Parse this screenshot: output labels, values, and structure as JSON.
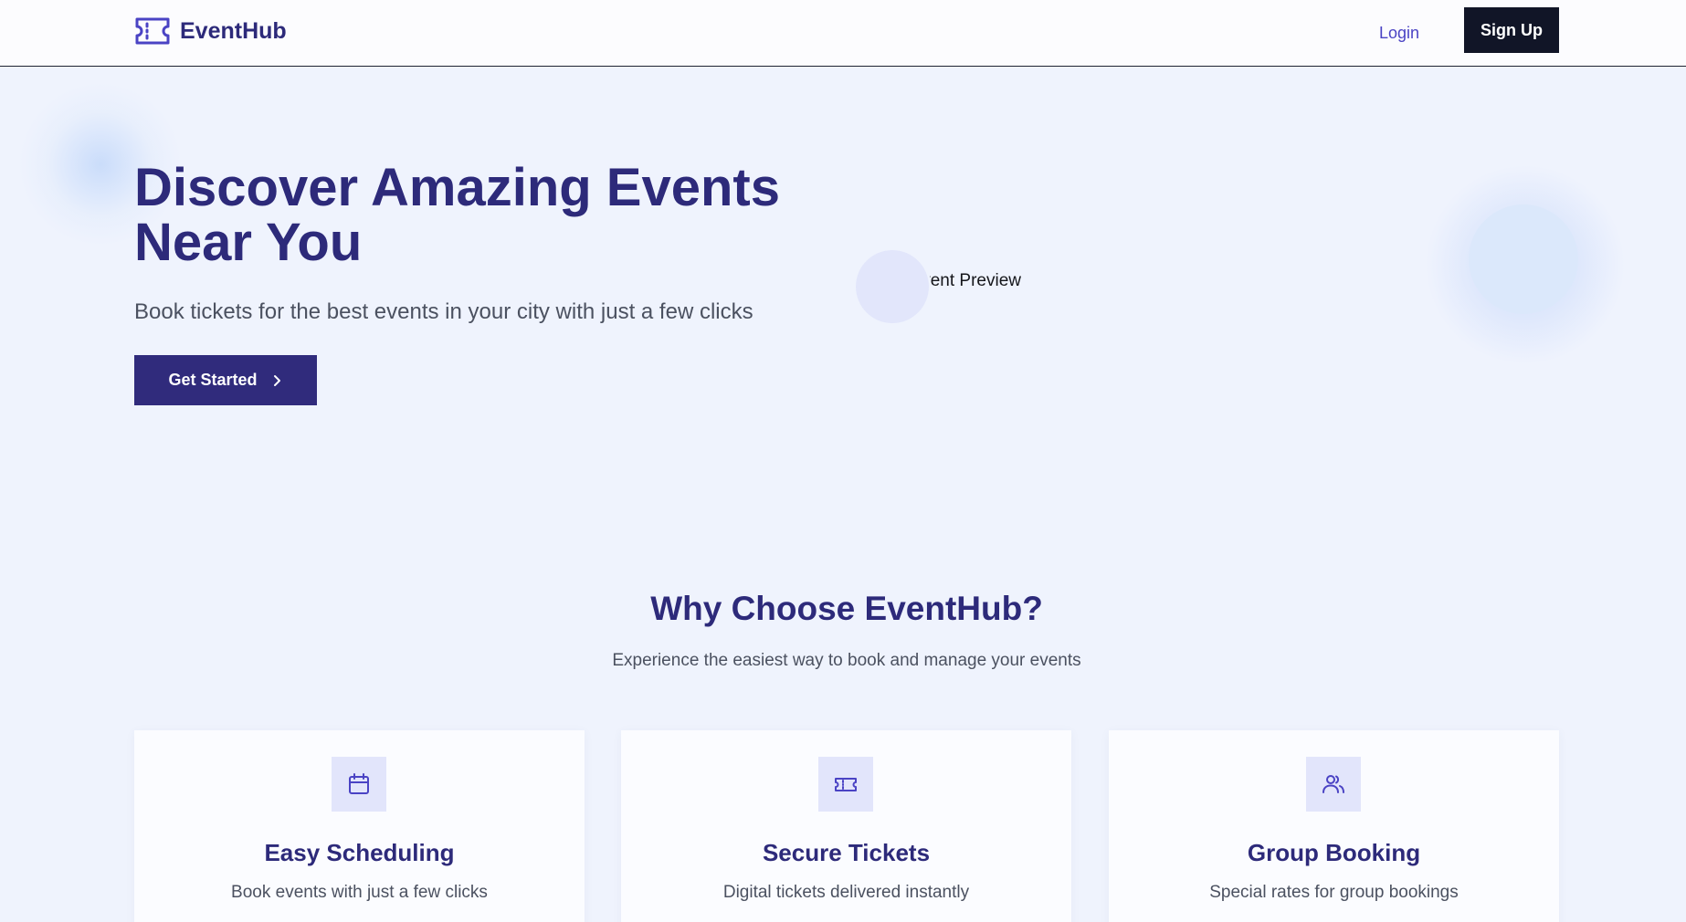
{
  "nav": {
    "brand": "EventHub",
    "login": "Login",
    "signup": "Sign Up"
  },
  "hero": {
    "title_line1": "Discover Amazing Events",
    "title_line2": "Near You",
    "subtitle": "Book tickets for the best events in your city with just a few clicks",
    "cta": "Get Started",
    "preview_alt": "Event Preview"
  },
  "features": {
    "title": "Why Choose EventHub?",
    "subtitle": "Experience the easiest way to book and manage your events",
    "cards": [
      {
        "icon": "calendar-icon",
        "title": "Easy Scheduling",
        "desc": "Book events with just a few clicks"
      },
      {
        "icon": "ticket-icon",
        "title": "Secure Tickets",
        "desc": "Digital tickets delivered instantly"
      },
      {
        "icon": "users-icon",
        "title": "Group Booking",
        "desc": "Special rates for group bookings"
      }
    ]
  },
  "colors": {
    "brand": "#2d2a7a",
    "accent": "#4a43c4",
    "signup_bg": "#111527",
    "cta_bg": "#302b7c",
    "page_bg": "#eff3fd"
  }
}
